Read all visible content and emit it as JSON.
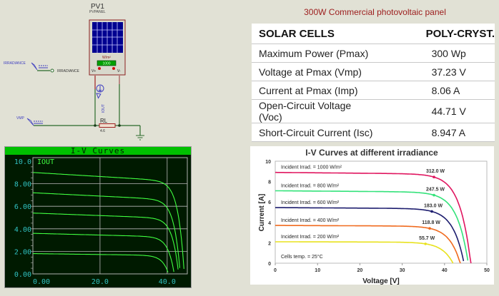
{
  "schematic": {
    "component_ref": "PV1",
    "component_type": "PVPANEL",
    "irradiance_unit": "W/m²",
    "irradiance_display": "1000",
    "pin_vplus": "V+",
    "pin_vminus": "V-",
    "irradiance_terminal": "IRRADIANCE",
    "irradiance_pin_label": "IRRADIANCE",
    "vmp_terminal": "VMP",
    "current_probe": "IOUT",
    "resistor_ref": "RL",
    "resistor_value": "4.6"
  },
  "panel_title": "300W Commercial photovoltaic panel",
  "spec_table": {
    "header": [
      "SOLAR CELLS",
      "POLY-CRYST."
    ],
    "rows": [
      [
        "Maximum Power (Pmax)",
        "300 Wp"
      ],
      [
        "Voltage at Pmax (Vmp)",
        "37.23 V"
      ],
      [
        "Current at Pmax (Imp)",
        "8.06 A"
      ],
      [
        "Open-Circuit Voltage (Voc)",
        "44.71 V"
      ],
      [
        "Short-Circuit Current (Isc)",
        "8.947 A"
      ]
    ]
  },
  "chart_data": [
    {
      "type": "line",
      "title": "I-V Curves",
      "trace_label": "IOUT",
      "xlim": [
        0,
        46
      ],
      "ylim": [
        0,
        10
      ],
      "x_ticks": [
        "0.00",
        "20.0",
        "40.0"
      ],
      "y_ticks": [
        "0.00",
        "2.00",
        "4.00",
        "6.00",
        "8.00",
        "10.0"
      ],
      "grid": true,
      "colors": {
        "background": "#001a00",
        "trace": "#40ff40",
        "title_bar": "#00c000",
        "ticks": "#30c0c0"
      },
      "series": [
        {
          "isc": 9.0,
          "voc": 45.1
        },
        {
          "isc": 7.2,
          "voc": 43.9
        },
        {
          "isc": 5.4,
          "voc": 43.4
        },
        {
          "isc": 3.6,
          "voc": 42.1
        },
        {
          "isc": 1.8,
          "voc": 40.4
        }
      ]
    },
    {
      "type": "line",
      "title": "I-V Curves at different irradiance",
      "xlabel": "Voltage [V]",
      "ylabel": "Current [A]",
      "xlim": [
        0,
        50
      ],
      "ylim": [
        0,
        10
      ],
      "x_ticks": [
        "0",
        "10",
        "20",
        "30",
        "40",
        "50"
      ],
      "y_ticks": [
        "0",
        "2",
        "4",
        "6",
        "8",
        "10"
      ],
      "annotation": "Cells temp. = 25°C",
      "series": [
        {
          "name": "Incident Irrad. = 1000 W/m²",
          "isc": 8.9,
          "voc": 46.2,
          "mpp_v": 37.5,
          "mpp_label": "312.0 W",
          "color": "#e0155f"
        },
        {
          "name": "Incident Irrad. = 800 W/m²",
          "isc": 7.1,
          "voc": 45.6,
          "mpp_v": 37.5,
          "mpp_label": "247.5 W",
          "color": "#33e27a"
        },
        {
          "name": "Incident Irrad. = 600 W/m²",
          "isc": 5.45,
          "voc": 44.6,
          "mpp_v": 37.0,
          "mpp_label": "183.0 W",
          "color": "#1c1c6e"
        },
        {
          "name": "Incident Irrad. = 400 W/m²",
          "isc": 3.7,
          "voc": 43.7,
          "mpp_v": 36.5,
          "mpp_label": "118.8 W",
          "color": "#f06a1e"
        },
        {
          "name": "Incident Irrad. = 200 W/m²",
          "isc": 2.1,
          "voc": 42.0,
          "mpp_v": 35.5,
          "mpp_label": "55.7 W",
          "color": "#e8e21e"
        }
      ]
    }
  ]
}
